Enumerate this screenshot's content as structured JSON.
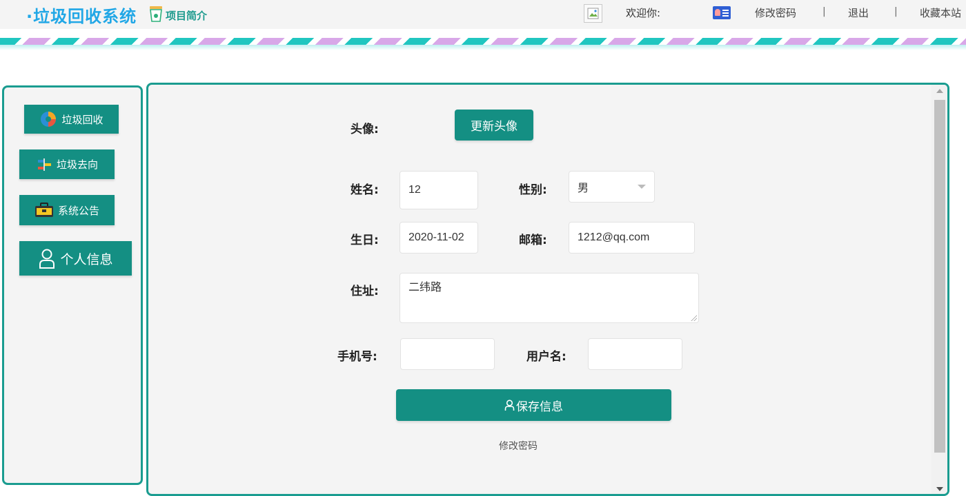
{
  "header": {
    "brand": "·垃圾回收系统",
    "intro_link": "项目简介",
    "welcome": "欢迎你:",
    "change_password": "修改密码",
    "separator": "|",
    "logout": "退出",
    "bookmark": "收藏本站"
  },
  "sidebar": {
    "items": [
      {
        "label": "垃圾回收",
        "icon": "recycle-icon"
      },
      {
        "label": "垃圾去向",
        "icon": "direction-icon"
      },
      {
        "label": "系统公告",
        "icon": "briefcase-icon"
      },
      {
        "label": "个人信息",
        "icon": "user-icon"
      }
    ]
  },
  "form": {
    "avatar_label": "头像:",
    "update_avatar_button": "更新头像",
    "name_label": "姓名:",
    "name_value": "12",
    "gender_label": "性别:",
    "gender_value": "男",
    "birthday_label": "生日:",
    "birthday_value": "2020-11-02",
    "email_label": "邮箱:",
    "email_value": "1212@qq.com",
    "address_label": "住址:",
    "address_value": "二纬路",
    "phone_label": "手机号:",
    "phone_value": "",
    "username_label": "用户名:",
    "username_value": "",
    "save_button": "保存信息",
    "change_password_link": "修改密码"
  },
  "colors": {
    "accent": "#148f83",
    "brand": "#21a7e6",
    "border": "#1a9c90"
  }
}
